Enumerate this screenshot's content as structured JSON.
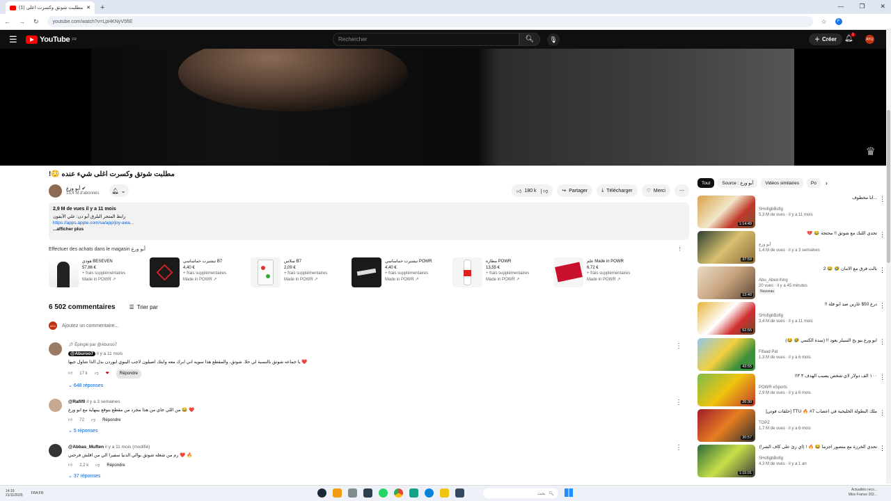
{
  "browser": {
    "tab_title": "(1) مطلبت شوتق وكسرت اعلى...",
    "url": "youtube.com/watch?v=LpHKNyV5fIE",
    "profile_initial": "F"
  },
  "header": {
    "logo_text": "YouTube",
    "region": "FR",
    "search_placeholder": "Rechercher",
    "create_label": "Créer",
    "notif_count": "1",
    "avatar_text": "AYU"
  },
  "video": {
    "title": "مطلبت شوتق وكسرت اغلى شيء عنده 😳!",
    "channel": "أبو ورع",
    "subscribers": "13,4 M d'abonnés",
    "likes": "180 k",
    "share": "Partager",
    "download": "Télécharger",
    "thanks": "Merci",
    "views_date": "2,9 M de vues  il y a 11 mois",
    "desc_line1": "رابط المتجر البلرق أبو دن: علي الآيفون",
    "desc_link": "https://apps.apple.com/sa/app/joy-awa...",
    "desc_more": "...afficher plus"
  },
  "shop": {
    "header": "Effectuer des achats dans le magasin أبو ورع",
    "products": [
      {
        "name": "هودي BESEVEN",
        "price": "57,86 €",
        "fees": "+ frais supplémentaires",
        "store": "Made in POWR ↗"
      },
      {
        "name": "تيشيرت خماساسي B7",
        "price": "4,40 €",
        "fees": "+ frais supplémentaires",
        "store": "Made in POWR ↗"
      },
      {
        "name": "سلاس B7",
        "price": "2,09 €",
        "fees": "+ frais supplémentaires",
        "store": "Made in POWR ↗"
      },
      {
        "name": "تيشيرت خماساسي POWR",
        "price": "4,40 €",
        "fees": "+ frais supplémentaires",
        "store": "Made in POWR ↗"
      },
      {
        "name": "مطارة POWR",
        "price": "13,55 €",
        "fees": "+ frais supplémentaires",
        "store": "Made in POWR ↗"
      },
      {
        "name": "علم Made in POWR",
        "price": "6,72 €",
        "fees": "+ frais supplémentaires",
        "store": "Made in POWR ↗"
      }
    ]
  },
  "comments": {
    "count": "6 502 commentaires",
    "sort": "Trier par",
    "add_placeholder": "Ajoutez un commentaire...",
    "items": [
      {
        "pinned": "Épinglé par @Aburoo7",
        "handle": "@Aburoo7",
        "time": "il y a 11 mois",
        "text": "يا جماعه شوتق بالنسبة لي حلا. شوتق، والمقطع هذا سويه اني ابرك معه وايتك اصيلون لاجب اليبوي ابوردن بدل الذا تتتاول جيها ❤️",
        "likes": "17 k",
        "reply": "Répondre",
        "replies": "648 réponses"
      },
      {
        "pinned": "",
        "handle": "@Rafif0",
        "time": "il y a 3 semaines",
        "text": "من اللي جاي من هذا مجرد من مقطع بتوقع بينهاية مع ابو ورع 😂 ❤️",
        "likes": "72",
        "reply": "Répondre",
        "replies": "5 réponses"
      },
      {
        "pinned": "",
        "handle": "@Abbas_Muften",
        "time": "il y a 11 mois (modifié)",
        "text": "رم من شغله شوتق بوالي الدنيا سفيرا الي من اقلش فرحتي ❤️ 🔥",
        "likes": "2,2 k",
        "reply": "Répondre",
        "replies": "37 réponses"
      }
    ]
  },
  "rail": {
    "chips": [
      "Tout",
      "Source : أبو ورع",
      "Vidéos similaires",
      "Po"
    ],
    "videos": [
      {
        "title": "...أنا مخطوف",
        "channel": "SHofigbBofig",
        "meta": "5,3 M de vues · il y a 11 mois",
        "duration": "1:14:49",
        "badge": ""
      },
      {
        "title": "تحدي اللبك مع شوتق !! محتجة 😂 💔",
        "channel": "أبو ورع",
        "meta": "1,4 M de vues · il y a 3 semaines",
        "duration": "37:59",
        "badge": ""
      },
      {
        "title": "بالت فرق مع الأمان 🤣 😂 2",
        "channel": "Abu_Abed King",
        "meta": "20 vues · il y a 45 minutes",
        "duration": "13:40",
        "badge": "Nouveau"
      },
      {
        "title": "درع 50$ غازين ضد أبو فلة !!",
        "channel": "SHofigbBofig",
        "meta": "3,4 M de vues · il y a 11 mois",
        "duration": "52:55",
        "badge": ""
      },
      {
        "title": "ابو ورع بيو يح السيلر يعود !! (سدة الكتمي 🤣 😂)",
        "channel": "Fifaad Pat",
        "meta": "1,3 M de vues · il y a 6 mois",
        "duration": "43:55",
        "badge": ""
      },
      {
        "title": "١٠٠ الف دولار لأي شخص يصيب الهدف ٣ ٣!!",
        "channel": "POWR eSports",
        "meta": "2,9 M de vues · il y a 6 mois",
        "duration": "26:30",
        "badge": ""
      },
      {
        "title": "ملك البطولة الخليجية في اعصاب TTU 🔥 #7 [حلقات فوتي]",
        "channel": "TOPZ",
        "meta": "1,7 M de vues · il y a 6 mois",
        "duration": "30:57",
        "badge": ""
      },
      {
        "title": "تحدي الخرزة مع منصور اجزما 😂 🔥 ! (اي رئ على كاف الشر!)",
        "channel": "SHofigbBofig",
        "meta": "4,3 M de vues · il y a 1 an",
        "duration": "1:15:01",
        "badge": ""
      }
    ]
  },
  "taskbar": {
    "time": "14:19",
    "date": "21/11/2025",
    "lang": "FRA FR",
    "search_text": "بحث",
    "news": "Actualités reco...",
    "news2": "Miss France 202..."
  }
}
